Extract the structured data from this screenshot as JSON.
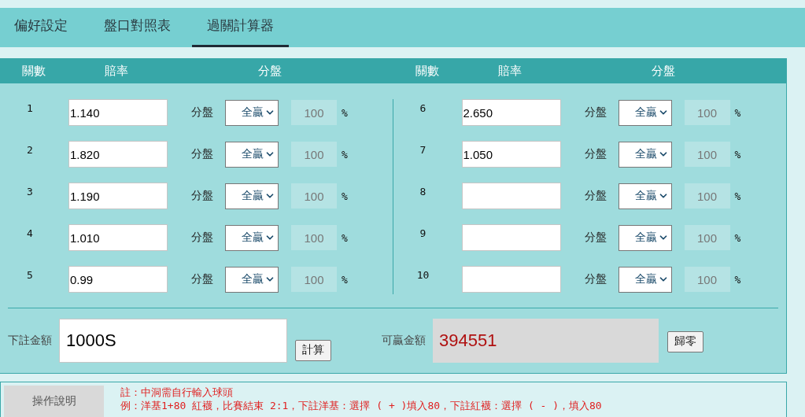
{
  "tabs": [
    {
      "label": "偏好設定",
      "selected": false
    },
    {
      "label": "盤口對照表",
      "selected": false
    },
    {
      "label": "過關計算器",
      "selected": true
    }
  ],
  "table_header": [
    {
      "columns": [
        "關數",
        "賠率",
        "分盤"
      ]
    },
    {
      "columns": [
        "關數",
        "賠率",
        "分盤"
      ]
    }
  ],
  "legs": [
    [
      {
        "number": "1",
        "odds": "1.140",
        "handicap_label": "分盤",
        "handicap": "全贏",
        "percent": "100",
        "unit": "%"
      },
      {
        "number": "2",
        "odds": "1.820",
        "handicap_label": "分盤",
        "handicap": "全贏",
        "percent": "100",
        "unit": "%"
      },
      {
        "number": "3",
        "odds": "1.190",
        "handicap_label": "分盤",
        "handicap": "全贏",
        "percent": "100",
        "unit": "%"
      },
      {
        "number": "4",
        "odds": "1.010",
        "handicap_label": "分盤",
        "handicap": "全贏",
        "percent": "100",
        "unit": "%"
      },
      {
        "number": "5",
        "odds": "0.99",
        "handicap_label": "分盤",
        "handicap": "全贏",
        "percent": "100",
        "unit": "%"
      }
    ],
    [
      {
        "number": "6",
        "odds": "2.650",
        "handicap_label": "分盤",
        "handicap": "全贏",
        "percent": "100",
        "unit": "%"
      },
      {
        "number": "7",
        "odds": "1.050",
        "handicap_label": "分盤",
        "handicap": "全贏",
        "percent": "100",
        "unit": "%"
      },
      {
        "number": "8",
        "handicap_label": "分盤",
        "handicap": "全贏",
        "percent": "100",
        "unit": "%"
      },
      {
        "number": "9",
        "handicap_label": "分盤",
        "handicap": "全贏",
        "percent": "100",
        "unit": "%"
      },
      {
        "number": "10",
        "handicap_label": "分盤",
        "handicap": "全贏",
        "percent": "100",
        "unit": "%"
      }
    ]
  ],
  "stake": {
    "label": "下註金額",
    "value": "1000S",
    "calculate_button": "計算"
  },
  "payout": {
    "label": "可贏金額",
    "value": "394551",
    "reset_button": "歸零"
  },
  "instructions": {
    "button": "操作說明",
    "notes": [
      "註：中洞需自行輸入球頭",
      "例：洋基1+80 紅襪，比賽結束 2:1，下註洋基：選擇 ( + )填入80，下註紅襪：選擇 ( - )，填入80"
    ]
  }
}
